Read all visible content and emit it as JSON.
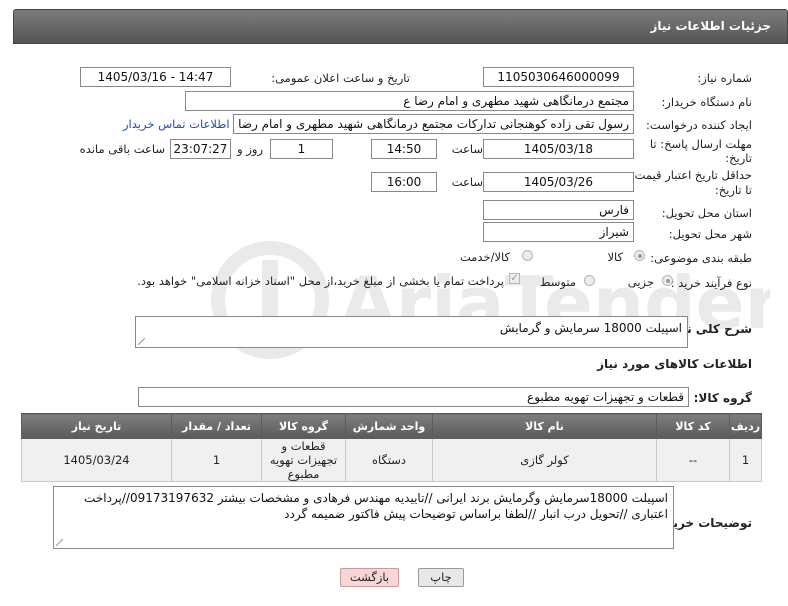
{
  "header": {
    "title": "جزئیات اطلاعات نیاز"
  },
  "fields": {
    "need_number_label": "شماره نیاز:",
    "need_number": "1105030646000099",
    "announce_label": "تاریخ و ساعت اعلان عمومی:",
    "announce_value": "1405/03/16 - 14:47",
    "buyer_org_label": "نام دستگاه خریدار:",
    "buyer_org": "مجتمع درمانگاهی شهید مطهری و امام رضا  ع",
    "creator_label": "ایجاد کننده درخواست:",
    "creator": "رسول تقی زاده کوهنجانی تدارکات مجتمع درمانگاهی شهید مطهری و امام رضا  ع",
    "contact_link": "اطلاعات تماس خریدار",
    "deadline_label_1": "مهلت ارسال پاسخ: تا",
    "deadline_label_2": "تاریخ:",
    "deadline_date": "1405/03/18",
    "time_label": "ساعت",
    "deadline_time": "14:50",
    "days_value": "1",
    "days_label": "روز و",
    "remaining_time": "23:07:27",
    "remaining_label": "ساعت باقی مانده",
    "validity_label_1": "حداقل تاریخ اعتبار قیمت:",
    "validity_label_2": "تا تاریخ:",
    "validity_date": "1405/03/26",
    "validity_time": "16:00",
    "province_label": "استان محل تحویل:",
    "province": "فارس",
    "city_label": "شهر محل تحویل:",
    "city": "شیراز",
    "category_label": "طبقه بندی موضوعی:",
    "category_options": [
      "کالا",
      "کالا/خدمت"
    ],
    "process_label": "نوع فرآیند خرید :",
    "process_options": [
      "جزیی",
      "متوسط"
    ],
    "payment_note": "پرداخت تمام یا بخشی از مبلغ خرید،از محل \"اسناد خزانه اسلامی\" خواهد بود."
  },
  "summary": {
    "label": "شرح کلی نیاز:",
    "value": "اسپیلت 18000 سرمایش و گرمایش"
  },
  "goods_section_title": "اطلاعات کالاهای مورد نیاز",
  "goods_group": {
    "label": "گروه کالا:",
    "value": "قطعات و تجهیزات تهویه مطبوع"
  },
  "table": {
    "headers": [
      "ردیف",
      "کد کالا",
      "نام کالا",
      "واحد شمارش",
      "گروه کالا",
      "تعداد / مقدار",
      "تاریخ نیاز"
    ],
    "rows": [
      [
        "1",
        "--",
        "کولر گازی",
        "دستگاه",
        "قطعات و تجهیزات تهویه مطبوع",
        "1",
        "1405/03/24"
      ]
    ]
  },
  "buyer_notes": {
    "label": "توضیحات خریدار:",
    "value": "اسپیلت 18000سرمایش وگرمایش برند ایرانی //تاییدیه مهندس فرهادی و مشخصات بیشتر 09173197632//پرداخت اعتباری //تحویل درب انبار //لطفا براساس توضیحات پیش فاکتور ضمیمه گردد"
  },
  "buttons": {
    "print": "چاپ",
    "back": "بازگشت"
  },
  "watermark_text": "AriaTender.net",
  "colors": {
    "header_bg": "#666666",
    "link": "#1f4fb5",
    "back_button": "#f6d6d6",
    "print_button": "#e8e8e8"
  }
}
